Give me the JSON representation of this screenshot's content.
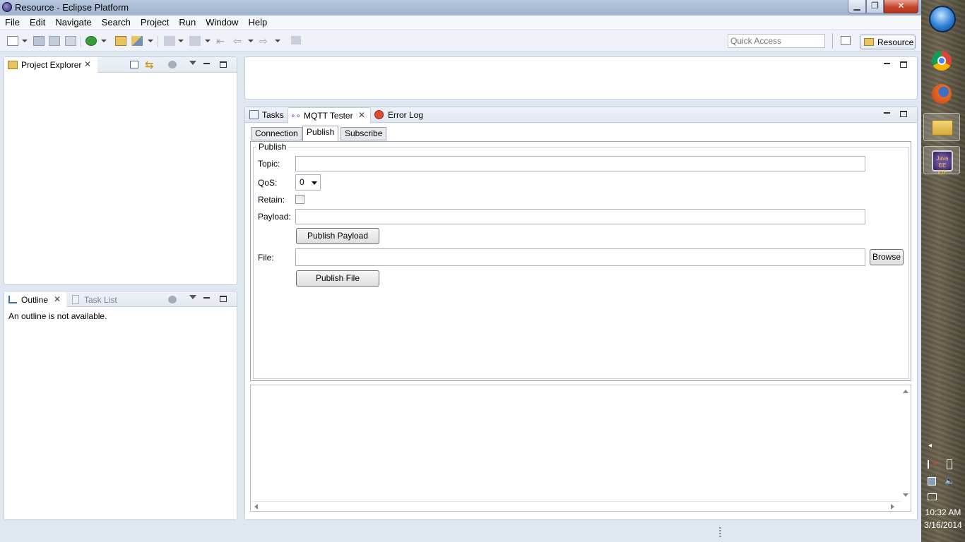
{
  "window": {
    "title": "Resource - Eclipse Platform"
  },
  "menu": [
    "File",
    "Edit",
    "Navigate",
    "Search",
    "Project",
    "Run",
    "Window",
    "Help"
  ],
  "toolbar": {
    "quick_access_placeholder": "Quick Access",
    "perspective_label": "Resource"
  },
  "project_explorer": {
    "tab_label": "Project Explorer"
  },
  "outline": {
    "tab_label": "Outline",
    "other_tab_label": "Task List",
    "empty_message": "An outline is not available."
  },
  "bottom_view": {
    "tabs": [
      "Tasks",
      "MQTT Tester",
      "Error Log"
    ],
    "subtabs": [
      "Connection",
      "Publish",
      "Subscribe"
    ],
    "publish": {
      "group_label": "Publish",
      "topic_label": "Topic:",
      "topic_value": "",
      "qos_label": "QoS:",
      "qos_value": "0",
      "retain_label": "Retain:",
      "payload_label": "Payload:",
      "payload_value": "",
      "publish_payload_button": "Publish Payload",
      "file_label": "File:",
      "file_value": "",
      "browse_button": "Browse",
      "publish_file_button": "Publish File"
    }
  },
  "taskbar": {
    "time": "10:32 AM",
    "date": "3/16/2014",
    "apps": [
      "chrome-icon",
      "firefox-icon",
      "file-explorer-icon",
      "eclipse-javaee-icon"
    ]
  },
  "colors": {
    "accent": "#2b5797",
    "panel_border": "#c3ccd8",
    "close_red": "#c7452c"
  }
}
